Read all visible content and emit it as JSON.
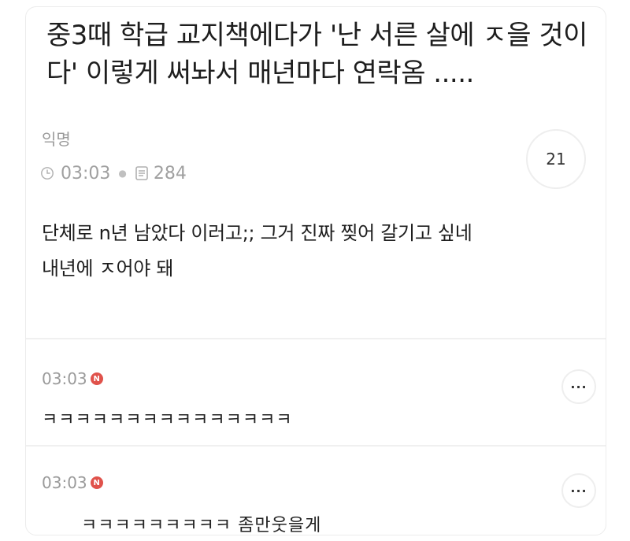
{
  "post": {
    "title": "중3때 학급 교지책에다가 '난 서른 살에 ㅈ을 것이다' 이렇게 써놔서 매년마다 연락옴 .....",
    "author": "익명",
    "time": "03:03",
    "views": "284",
    "comment_count": "21",
    "body_line1": "단체로 n년 남았다 이러고;; 그거 진짜 찢어 갈기고 싶네",
    "body_line2": "내년에 ㅈ어야 돼"
  },
  "comments": [
    {
      "time": "03:03",
      "badge": "N",
      "text": "ㅋㅋㅋㅋㅋㅋㅋㅋㅋㅋㅋㅋㅋㅋㅋ",
      "more": "···"
    },
    {
      "time": "03:03",
      "badge": "N",
      "text": "ㅋㅋㅋㅋㅋㅋㅋㅋㅋ 좀만웃을게",
      "more": "···"
    }
  ],
  "colors": {
    "badge": "#e0524b",
    "meta": "#9a9a9a",
    "border": "#ececec"
  },
  "icons": [
    "clock-icon",
    "views-icon",
    "more-options-icon"
  ]
}
